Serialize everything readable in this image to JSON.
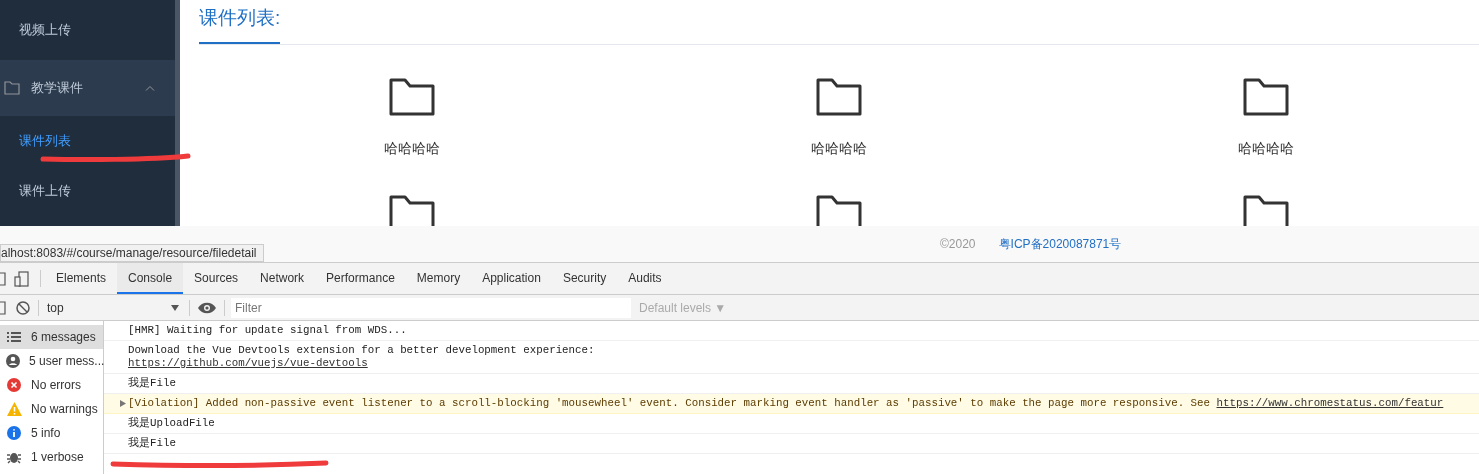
{
  "sidebar": {
    "items": [
      {
        "kind": "item",
        "label": "视频上传",
        "selected": false
      },
      {
        "kind": "group",
        "label": "教学课件",
        "expanded": true,
        "children": [
          {
            "label": "课件列表",
            "selected": true
          },
          {
            "label": "课件上传",
            "selected": false
          }
        ]
      }
    ]
  },
  "content": {
    "title": "课件列表:",
    "files": [
      {
        "kind": "named",
        "name": "哈哈哈哈"
      },
      {
        "kind": "named",
        "name": "哈哈哈哈"
      },
      {
        "kind": "named",
        "name": "哈哈哈哈"
      },
      {
        "kind": "clipped"
      },
      {
        "kind": "clipped"
      },
      {
        "kind": "clipped"
      }
    ]
  },
  "footer": {
    "copyright": "©2020",
    "icp": "粤ICP备2020087871号"
  },
  "status_url": "alhost:8083/#/course/manage/resource/filedetail",
  "devtools": {
    "tabs": [
      {
        "label": "Elements",
        "selected": false
      },
      {
        "label": "Console",
        "selected": true
      },
      {
        "label": "Sources",
        "selected": false
      },
      {
        "label": "Network",
        "selected": false
      },
      {
        "label": "Performance",
        "selected": false
      },
      {
        "label": "Memory",
        "selected": false
      },
      {
        "label": "Application",
        "selected": false
      },
      {
        "label": "Security",
        "selected": false
      },
      {
        "label": "Audits",
        "selected": false
      }
    ],
    "context": "top",
    "filter": {
      "placeholder": "Filter"
    },
    "levels": "Default levels ▼",
    "sidebar": [
      {
        "kind": "list",
        "label": "6 messages",
        "selected": true
      },
      {
        "kind": "user",
        "label": "5 user mess...",
        "selected": false
      },
      {
        "kind": "error",
        "label": "No errors",
        "selected": false
      },
      {
        "kind": "warning",
        "label": "No warnings",
        "selected": false
      },
      {
        "kind": "info",
        "label": "5 info",
        "selected": false
      },
      {
        "kind": "verbose",
        "label": "1 verbose",
        "selected": false
      }
    ],
    "messages": [
      {
        "kind": "log",
        "text": "[HMR] Waiting for update signal from WDS..."
      },
      {
        "kind": "log",
        "text": "Download the Vue Devtools extension for a better development experience:",
        "link": "https://github.com/vuejs/vue-devtools"
      },
      {
        "kind": "log",
        "text": "我是File"
      },
      {
        "kind": "violation",
        "text": "[Violation] Added non-passive event listener to a scroll-blocking 'mousewheel' event. Consider marking event handler as 'passive' to make the page more responsive. See ",
        "link": "https://www.chromestatus.com/featur"
      },
      {
        "kind": "log",
        "text": "我是UploadFile"
      },
      {
        "kind": "log",
        "text": "我是File"
      }
    ]
  }
}
